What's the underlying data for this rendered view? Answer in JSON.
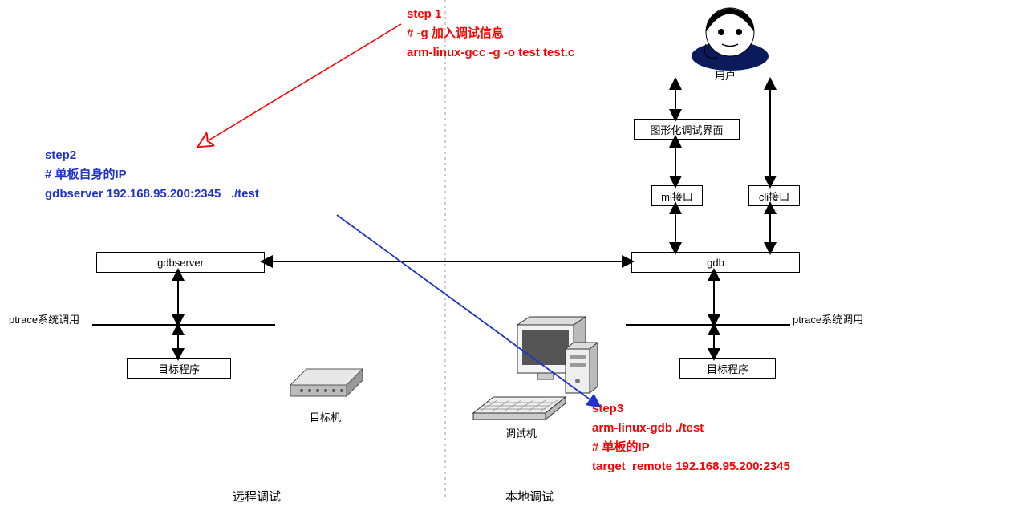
{
  "annotations": {
    "step1": "step 1\n# -g 加入调试信息\narm-linux-gcc -g -o test test.c",
    "step2": "step2\n# 单板自身的IP\ngdbserver 192.168.95.200:2345   ./test",
    "step3": "step3\narm-linux-gdb ./test\n# 单板的IP\ntarget  remote 192.168.95.200:2345"
  },
  "boxes": {
    "user": "用户",
    "gui_debug": "图形化调试界面",
    "mi": "mi接口",
    "cli": "cli接口",
    "gdbserver": "gdbserver",
    "gdb": "gdb",
    "ptrace_left": "ptrace系统调用",
    "ptrace_right": "ptrace系统调用",
    "target_prog_left": "目标程序",
    "target_prog_right": "目标程序"
  },
  "machine_labels": {
    "target": "目标机",
    "debug": "调试机"
  },
  "sections": {
    "remote": "远程调试",
    "local": "本地调试"
  }
}
